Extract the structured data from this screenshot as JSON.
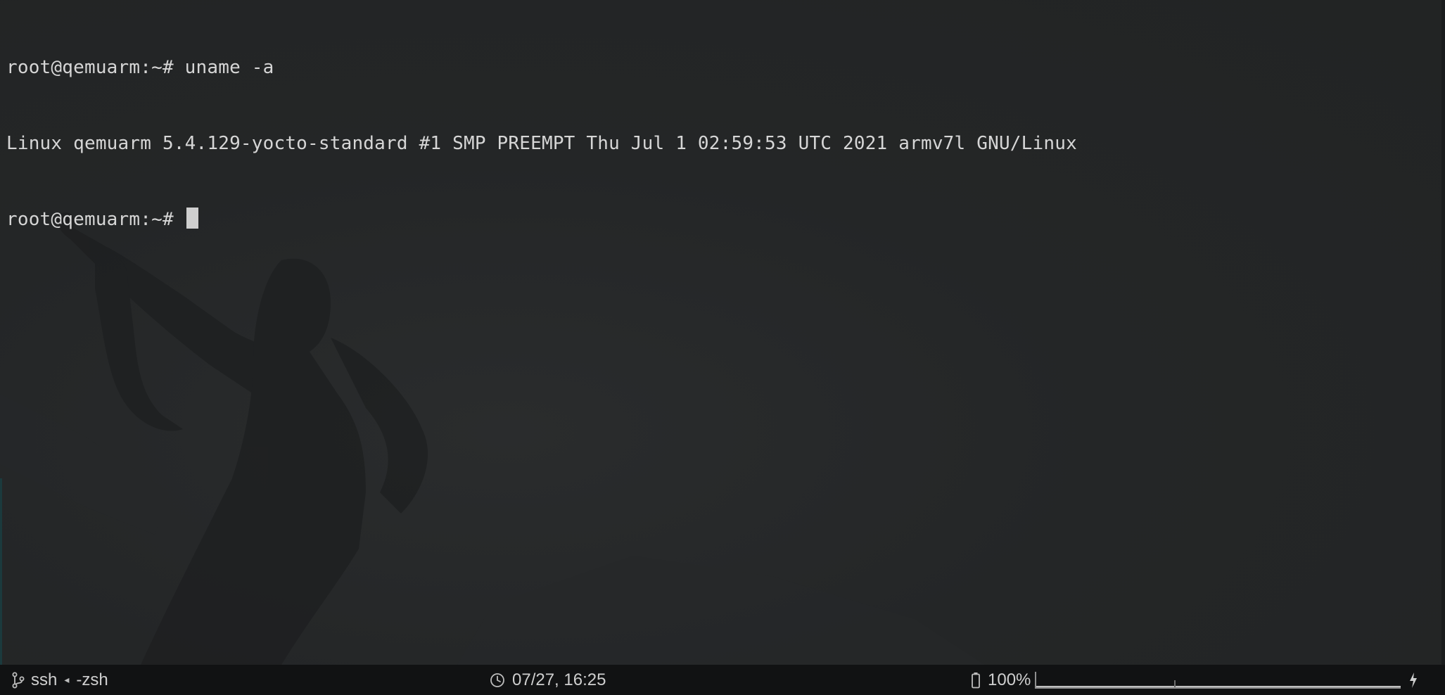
{
  "terminal": {
    "lines": [
      {
        "text": "root@qemuarm:~# uname -a"
      },
      {
        "text": "Linux qemuarm 5.4.129-yocto-standard #1 SMP PREEMPT Thu Jul 1 02:59:53 UTC 2021 armv7l GNU/Linux"
      },
      {
        "text": "root@qemuarm:~# "
      }
    ]
  },
  "statusbar": {
    "session_icon": "branch-icon",
    "session_name": "ssh",
    "separator": "◂",
    "parent_session": "-zsh",
    "clock_icon": "clock-icon",
    "datetime": "07/27, 16:25",
    "battery_icon": "battery-icon",
    "battery_percent": "100%",
    "battery_level": 1.0,
    "charging_icon": "bolt-icon"
  },
  "colors": {
    "background": "#232526",
    "text": "#d6d6d6",
    "statusbar_bg": "#111213",
    "cursor": "#cfcfcf"
  }
}
